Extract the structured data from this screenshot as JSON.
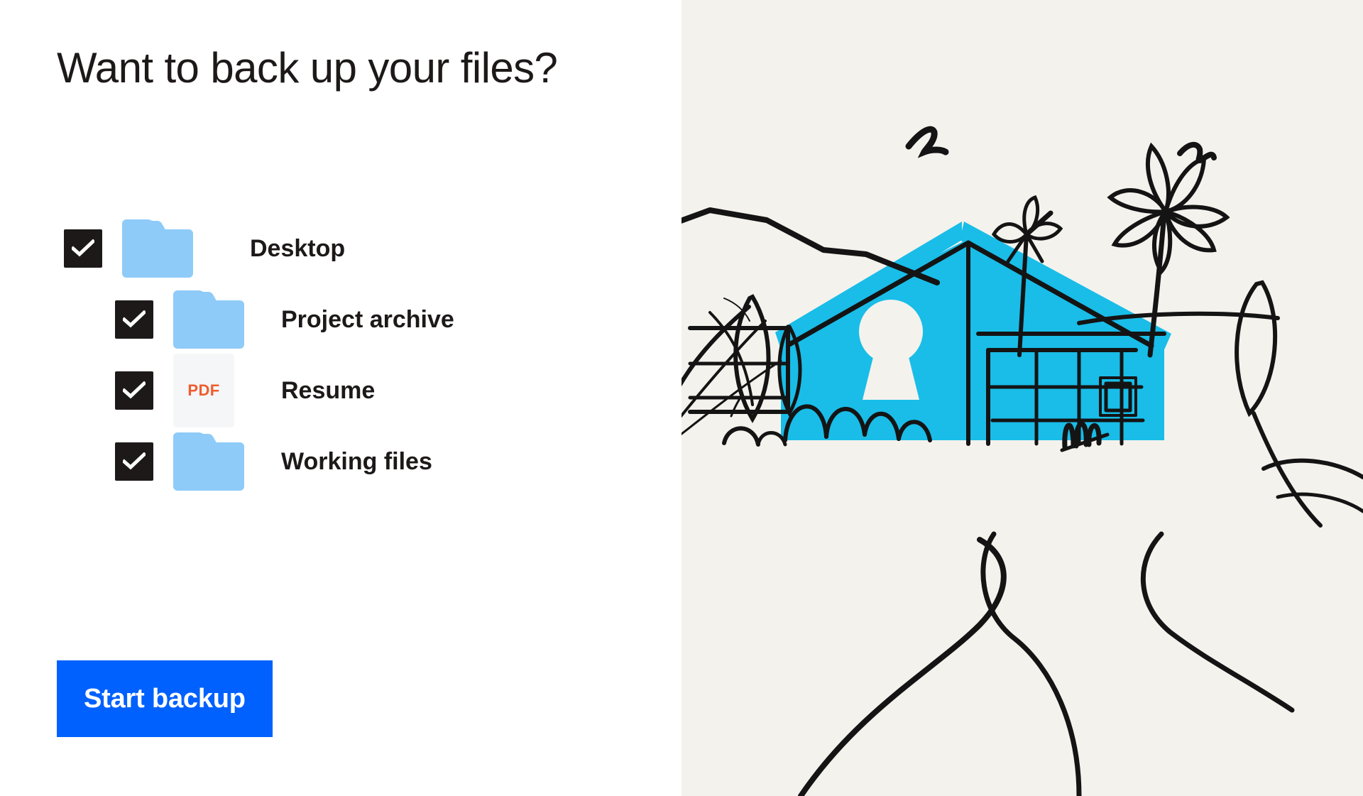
{
  "headline": "Want to back up your files?",
  "files": [
    {
      "label": "Desktop",
      "icon": "folder-icon",
      "checked": true,
      "indent": false
    },
    {
      "label": "Project archive",
      "icon": "folder-icon",
      "checked": true,
      "indent": true
    },
    {
      "label": "Resume",
      "icon": "pdf-file-icon",
      "checked": true,
      "indent": true,
      "file_type": "PDF"
    },
    {
      "label": "Working files",
      "icon": "folder-icon",
      "checked": true,
      "indent": true
    }
  ],
  "primary_action": {
    "label": "Start backup"
  },
  "illustration": {
    "name": "house-with-keyhole-illustration",
    "alt": "Line-drawn house with a keyhole on a cream background, surrounded by plants, birds and a winding path"
  },
  "colors": {
    "accent_blue": "#0061FE",
    "folder_blue": "#8ECBF8",
    "checkbox_black": "#1E1919",
    "pdf_orange": "#EE5D2F",
    "illustration_cyan": "#19BDE8",
    "illustration_background": "#F4F2ED",
    "panel_background": "#FFFFFF",
    "ink": "#1A1A1A"
  }
}
